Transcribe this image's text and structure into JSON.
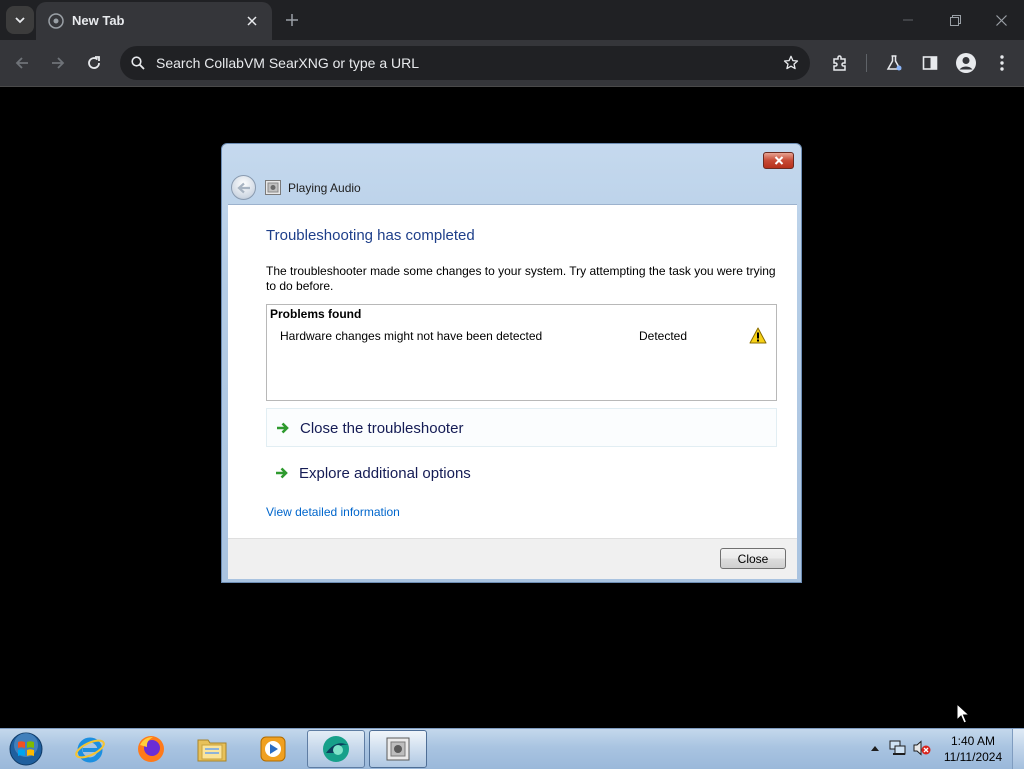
{
  "browser": {
    "tab": {
      "title": "New Tab"
    },
    "omnibox": {
      "placeholder": "Search CollabVM SearXNG or type a URL"
    },
    "icons": [
      "tab-search-icon",
      "new-tab-icon",
      "close-tab-icon",
      "minimize-icon",
      "restore-icon",
      "close-window-icon",
      "back-icon",
      "forward-icon",
      "reload-icon",
      "search-icon",
      "star-icon",
      "extensions-icon",
      "labs-icon",
      "side-panel-icon",
      "profile-icon",
      "menu-icon"
    ],
    "colors": {
      "chrome_dark": "#202124",
      "chrome_mid": "#35363a",
      "text": "#e8eaed"
    }
  },
  "dialog": {
    "title": "Playing Audio",
    "heading": "Troubleshooting has completed",
    "description": "The troubleshooter made some changes to your system. Try attempting the task you were trying to do before.",
    "problems": {
      "header": "Problems found",
      "items": [
        {
          "name": "Hardware changes might not have been detected",
          "status": "Detected",
          "icon": "warning-icon"
        }
      ]
    },
    "options": [
      {
        "label": "Close the troubleshooter"
      },
      {
        "label": "Explore additional options"
      }
    ],
    "details_link": "View detailed information",
    "close_button": "Close",
    "colors": {
      "heading": "#1e3f8a",
      "link": "#0066cc",
      "arrow": "#2e9a2e"
    }
  },
  "taskbar": {
    "apps": [
      "internet-explorer-icon",
      "firefox-icon",
      "file-explorer-icon",
      "media-player-icon",
      "browser-icon",
      "troubleshooter-icon"
    ],
    "clock": {
      "time": "1:40 AM",
      "date": "11/11/2024"
    },
    "tray_icons": [
      "show-hidden-icons-icon",
      "network-icon",
      "volume-muted-icon"
    ]
  }
}
